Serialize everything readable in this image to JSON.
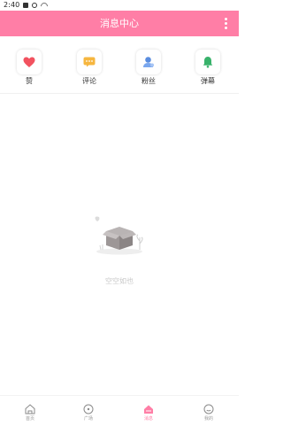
{
  "status_bar": {
    "time": "2:40"
  },
  "header": {
    "title": "消息中心",
    "bg_color": "#ff7ea6"
  },
  "categories": [
    {
      "label": "赞",
      "icon": "heart-icon",
      "color": "#f2525f"
    },
    {
      "label": "评论",
      "icon": "comment-icon",
      "color": "#f6b63f"
    },
    {
      "label": "粉丝",
      "icon": "fans-icon",
      "color": "#5a8ddf"
    },
    {
      "label": "弹幕",
      "icon": "bell-icon",
      "color": "#38b26b"
    }
  ],
  "empty_state": {
    "text": "空空如也",
    "icon": "empty-box-icon"
  },
  "tabbar": {
    "items": [
      {
        "label": "首页",
        "icon": "home-icon"
      },
      {
        "label": "广场",
        "icon": "compass-icon"
      },
      {
        "label": "消息",
        "icon": "message-icon",
        "active": true
      },
      {
        "label": "我的",
        "icon": "profile-icon"
      }
    ]
  }
}
